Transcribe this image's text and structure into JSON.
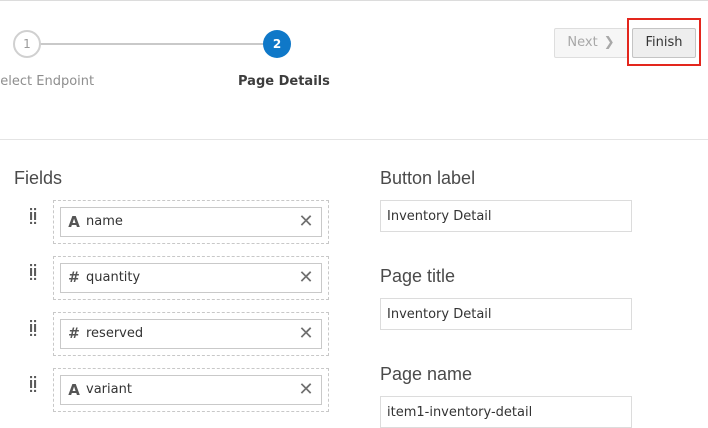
{
  "train": {
    "steps": [
      {
        "number": "1",
        "label": "Select Endpoint"
      },
      {
        "number": "2",
        "label": "Page Details"
      }
    ]
  },
  "toolbar": {
    "next_label": "Next",
    "next_chevron": "❯",
    "finish_label": "Finish"
  },
  "fields": {
    "title": "Fields",
    "items": [
      {
        "name": "name",
        "type_icon": "A",
        "type": "text"
      },
      {
        "name": "quantity",
        "type_icon": "#",
        "type": "number"
      },
      {
        "name": "reserved",
        "type_icon": "#",
        "type": "number"
      },
      {
        "name": "variant",
        "type_icon": "A",
        "type": "text"
      }
    ],
    "remove_icon": "✕",
    "drag_icon": "⠿"
  },
  "form": {
    "button_label": {
      "label": "Button label",
      "value": "Inventory Detail"
    },
    "page_title": {
      "label": "Page title",
      "value": "Inventory Detail"
    },
    "page_name": {
      "label": "Page name",
      "value": "item1-inventory-detail"
    }
  },
  "colors": {
    "accent": "#0f78c8",
    "highlight": "#e3261d"
  }
}
